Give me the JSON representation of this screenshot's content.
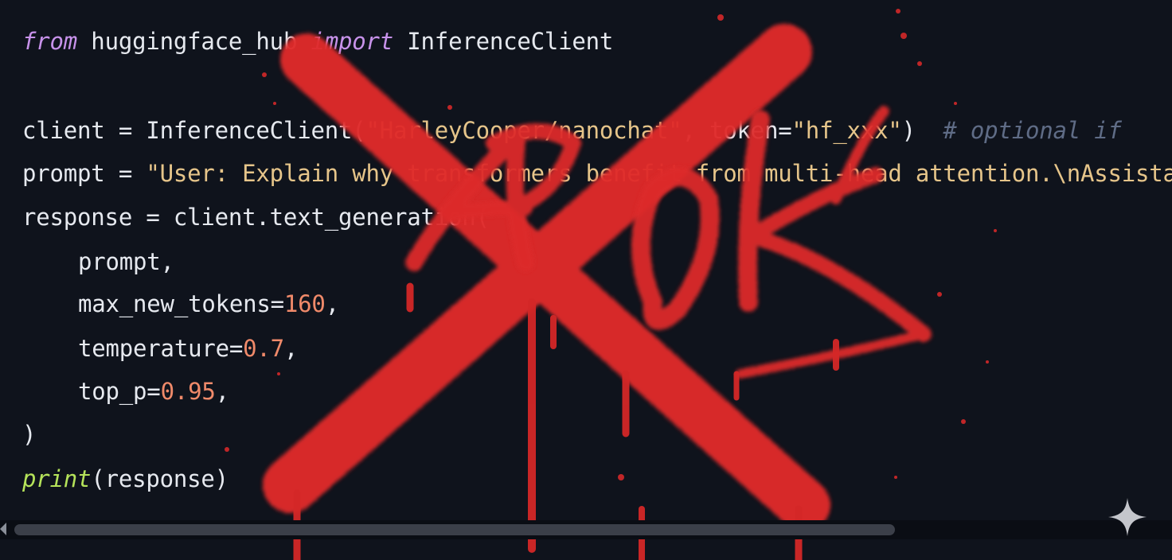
{
  "code": {
    "line1": {
      "kw_from": "from",
      "module": " huggingface_hub ",
      "kw_import": "import",
      "name": " InferenceClient"
    },
    "line3": {
      "pre": "client = InferenceClient(",
      "model": "\"HarleyCooper/nanochat\"",
      "mid": ", token=",
      "token": "\"hf_xxx\"",
      "close": ")  ",
      "comment": "# optional if"
    },
    "line4": {
      "pre": "prompt = ",
      "str": "\"User: Explain why transformers benefit from multi-head attention.\\nAssistant:\""
    },
    "line5": {
      "text": "response = client.text_generation("
    },
    "line6": {
      "text": "prompt,"
    },
    "line7": {
      "name": "max_new_tokens=",
      "value": "160",
      "comma": ","
    },
    "line8": {
      "name": "temperature=",
      "value": "0.7",
      "comma": ","
    },
    "line9": {
      "name": "top_p=",
      "value": "0.95",
      "comma": ","
    },
    "line10": {
      "text": ")"
    },
    "line11": {
      "fn": "print",
      "args": "(response)"
    }
  },
  "graffiti": {
    "tag": "ArOK"
  },
  "colors": {
    "background": "#0f131c",
    "keyword": "#c792ea",
    "string": "#e6c58a",
    "number": "#f08a6a",
    "comment": "#5f6c86",
    "print": "#b5e35a",
    "spray": "#e02a2a"
  },
  "icons": {
    "sparkle": "sparkle-icon"
  }
}
